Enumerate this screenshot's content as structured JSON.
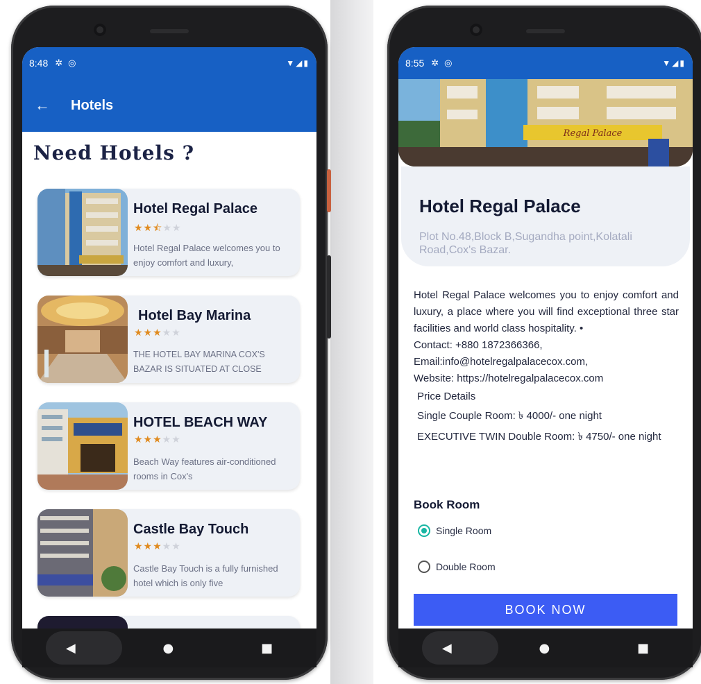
{
  "left": {
    "status": {
      "time": "8:48"
    },
    "appbar": {
      "back": "←",
      "title": "Hotels"
    },
    "heading": "Need Hotels ?",
    "hotels": [
      {
        "name": "Hotel Regal Palace",
        "rating": 2.5,
        "desc": "Hotel Regal Palace welcomes you to enjoy comfort and luxury,"
      },
      {
        "name": "Hotel Bay Marina",
        "rating": 3,
        "desc": "THE HOTEL BAY MARINA COX'S BAZAR IS SITUATED AT CLOSE"
      },
      {
        "name": "HOTEL BEACH WAY",
        "rating": 3,
        "desc": "Beach Way features air-conditioned rooms in Cox's"
      },
      {
        "name": "Castle Bay Touch",
        "rating": 3,
        "desc": "Castle Bay Touch is a fully furnished hotel which is only five"
      }
    ]
  },
  "right": {
    "status": {
      "time": "8:55"
    },
    "hotel": {
      "name": "Hotel Regal Palace",
      "address": "Plot No.48,Block B,Sugandha point,Kolatali Road,Cox's Bazar.",
      "sign": "Regal Palace"
    },
    "details": {
      "description": "Hotel Regal Palace welcomes you to enjoy comfort and luxury, a place where you will find exceptional three star facilities and world class hospitality. •",
      "contact": "Contact: +880 1872366366,",
      "email": "Email:info@hotelregalpalacecox.com,",
      "website": "Website: https://hotelregalpalacecox.com",
      "price_title": "Price Details",
      "price_single": "Single Couple Room: ৳ 4000/- one night",
      "price_exec": "EXECUTIVE TWIN Double Room: ৳ 4750/- one night"
    },
    "booking": {
      "label": "Book Room",
      "options": [
        "Single Room",
        "Double Room"
      ],
      "selected": "Single Room",
      "button": "BOOK NOW"
    }
  },
  "colors": {
    "primary": "#1760c4",
    "star": "#e08a1e",
    "accent": "#3c5cf4",
    "radio": "#18b6a3"
  },
  "icons": [
    "settings-icon",
    "sync-icon",
    "wifi-icon",
    "signal-icon",
    "battery-icon",
    "back-arrow-icon",
    "nav-back-icon",
    "nav-home-icon",
    "nav-recents-icon"
  ]
}
